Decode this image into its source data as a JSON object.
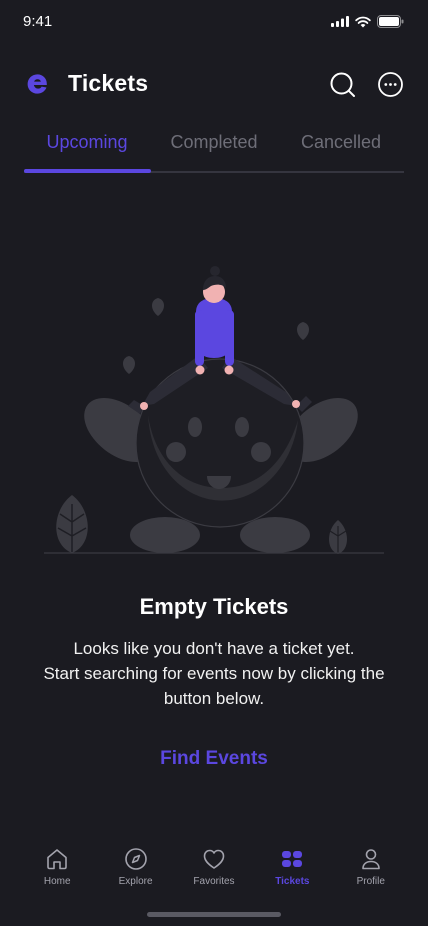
{
  "status_bar": {
    "time": "9:41"
  },
  "header": {
    "title": "Tickets",
    "logo_icon": "eventhub-logo-icon",
    "search_icon": "search-icon",
    "more_icon": "more-options-icon"
  },
  "tabs": [
    {
      "label": "Upcoming",
      "active": true
    },
    {
      "label": "Completed",
      "active": false
    },
    {
      "label": "Cancelled",
      "active": false
    }
  ],
  "empty_state": {
    "title": "Empty Tickets",
    "lines": [
      "Looks like you don't have a ticket yet.",
      "Start searching for events now by clicking the",
      "button below."
    ],
    "button_label": "Find Events"
  },
  "bottom_nav": [
    {
      "label": "Home",
      "icon": "home-icon",
      "active": false
    },
    {
      "label": "Explore",
      "icon": "compass-icon",
      "active": false
    },
    {
      "label": "Favorites",
      "icon": "heart-icon",
      "active": false
    },
    {
      "label": "Tickets",
      "icon": "ticket-icon",
      "active": true
    },
    {
      "label": "Profile",
      "icon": "profile-icon",
      "active": false
    }
  ],
  "colors": {
    "background": "#1b1b21",
    "accent": "#5b47e0",
    "inactive_tab": "#6e6e78",
    "nav_inactive": "#a3a3ad"
  }
}
